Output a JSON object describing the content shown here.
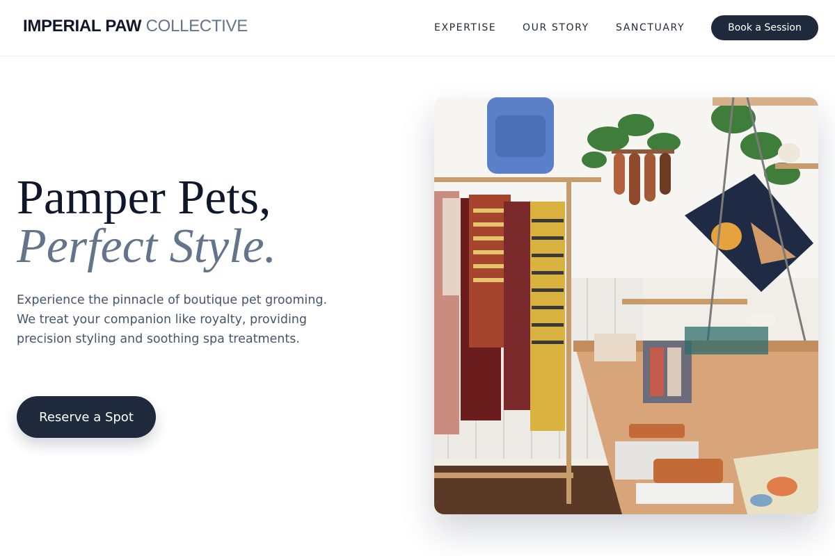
{
  "brand": {
    "name_strong": "IMPERIAL PAW",
    "name_light": "COLLECTIVE"
  },
  "nav": {
    "items": [
      {
        "label": "EXPERTISE"
      },
      {
        "label": "OUR STORY"
      },
      {
        "label": "SANCTUARY"
      }
    ],
    "cta_label": "Book a Session"
  },
  "hero": {
    "title_line1": "Pamper Pets,",
    "title_line2": "Perfect Style.",
    "subtitle": "Experience the pinnacle of boutique pet grooming. We treat your companion like royalty, providing precision styling and soothing spa treatments.",
    "cta_label": "Reserve a Spot",
    "image_alt": "Boutique shop interior with clothing racks, tote bags and accessories on display tables"
  },
  "colors": {
    "primary": "#1e293b",
    "heading": "#0f172a",
    "muted": "#64748b",
    "body_text": "#475569"
  }
}
